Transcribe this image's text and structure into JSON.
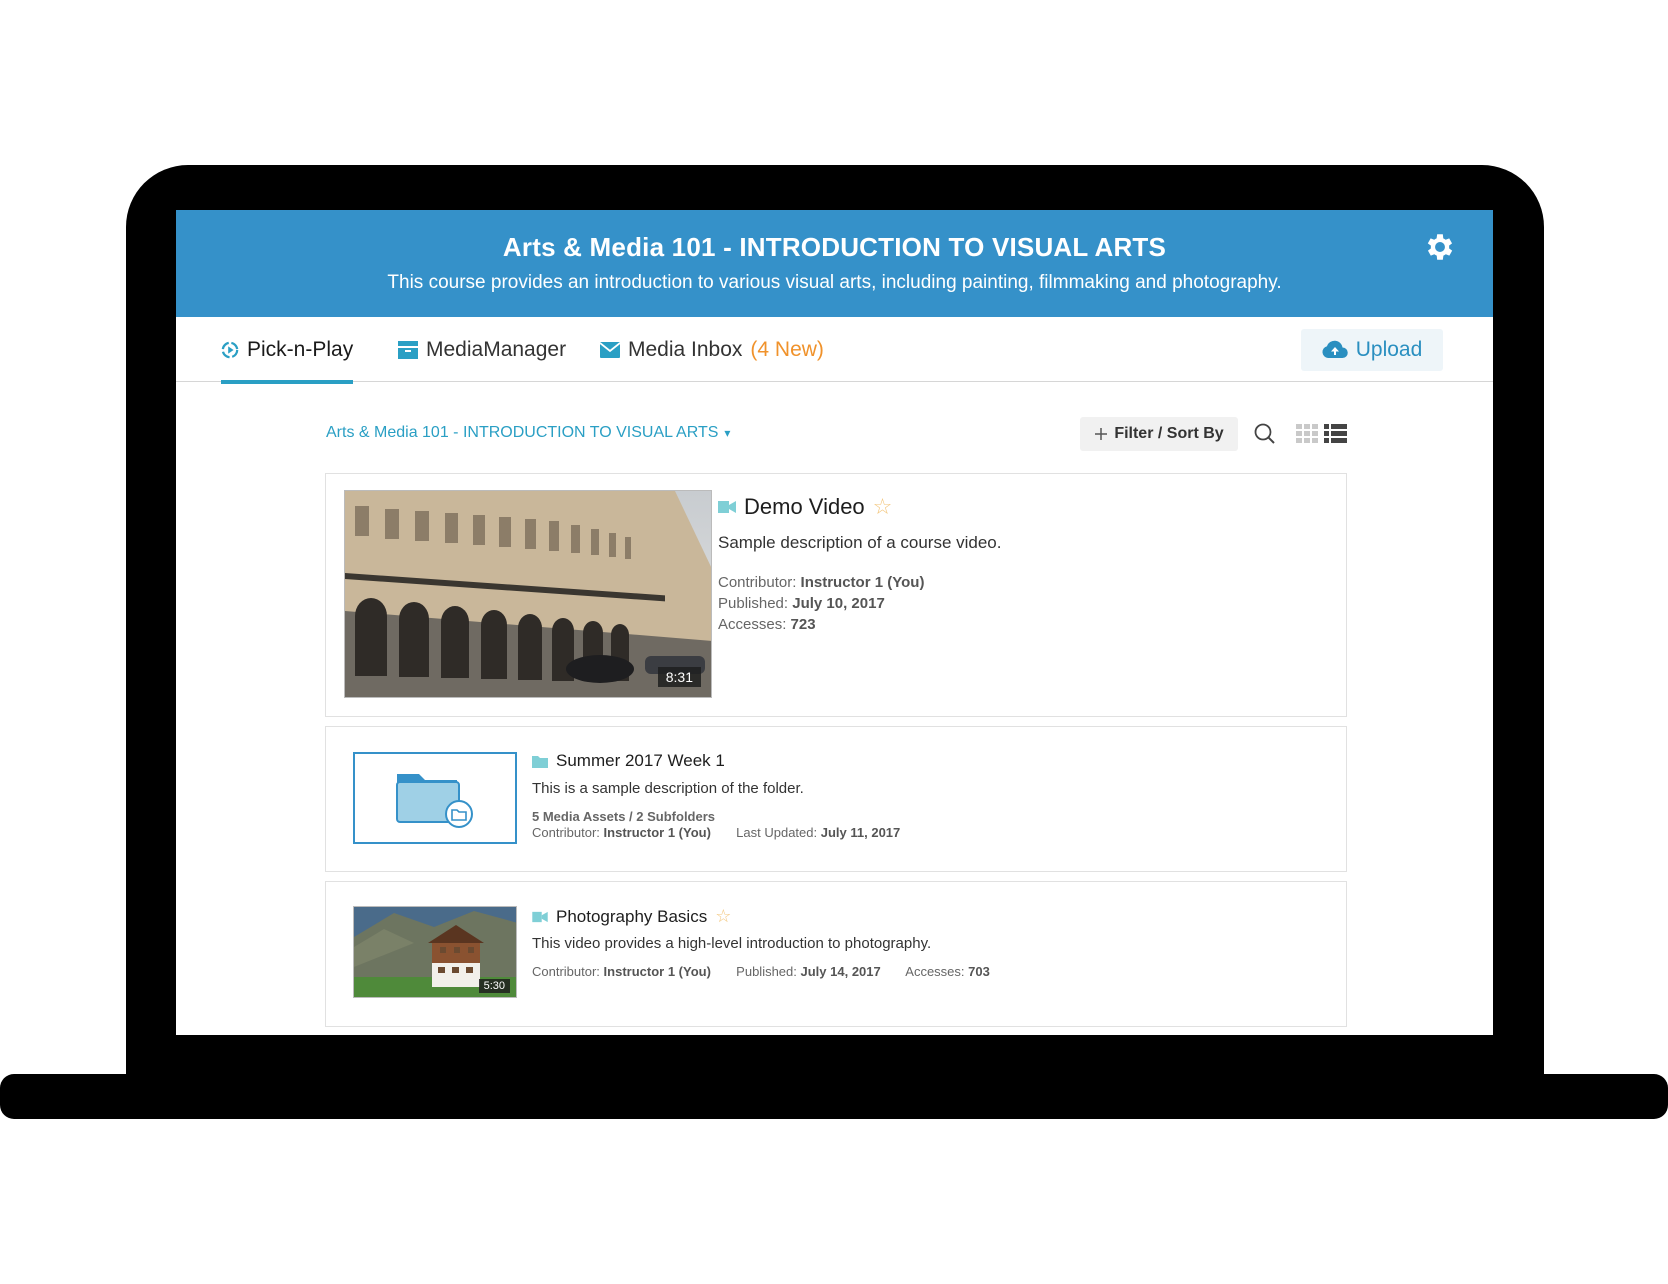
{
  "header": {
    "title": "Arts & Media 101 - INTRODUCTION TO VISUAL ARTS",
    "subtitle": "This course provides an introduction to various visual arts, including painting, filmmaking and photography."
  },
  "tabs": {
    "pick": "Pick-n-Play",
    "manager": "MediaManager",
    "inbox": "Media Inbox",
    "inbox_new": "(4 New)"
  },
  "upload_label": "Upload",
  "toolbar": {
    "breadcrumb": "Arts & Media 101 - INTRODUCTION TO VISUAL ARTS",
    "breadcrumb_caret": "▾",
    "filter_label": "Filter / Sort By"
  },
  "items": [
    {
      "title": "Demo Video",
      "description": "Sample description of a course video.",
      "duration": "8:31",
      "contributor_label": "Contributor:",
      "contributor": "Instructor 1 (You)",
      "published_label": "Published:",
      "published": "July 10, 2017",
      "accesses_label": "Accesses:",
      "accesses": "723"
    },
    {
      "title": "Summer 2017 Week 1",
      "description": "This is a sample description of the folder.",
      "counts": "5 Media Assets / 2 Subfolders",
      "contributor_label": "Contributor:",
      "contributor": "Instructor 1 (You)",
      "updated_label": "Last Updated:",
      "updated": "July 11, 2017"
    },
    {
      "title": "Photography Basics",
      "description": "This video provides a high-level introduction to photography.",
      "duration": "5:30",
      "contributor_label": "Contributor:",
      "contributor": "Instructor 1 (You)",
      "published_label": "Published:",
      "published": "July 14, 2017",
      "accesses_label": "Accesses:",
      "accesses": "703"
    }
  ],
  "colors": {
    "banner": "#3591c9",
    "accent": "#2a9fc4",
    "new_badge": "#f0922b",
    "star": "#f3c77e"
  },
  "icons": [
    "gear-icon",
    "pick-n-play-icon",
    "media-manager-icon",
    "inbox-icon",
    "cloud-upload-icon",
    "plus-icon",
    "search-icon",
    "grid-view-icon",
    "list-view-icon",
    "video-icon",
    "folder-icon",
    "star-icon"
  ]
}
